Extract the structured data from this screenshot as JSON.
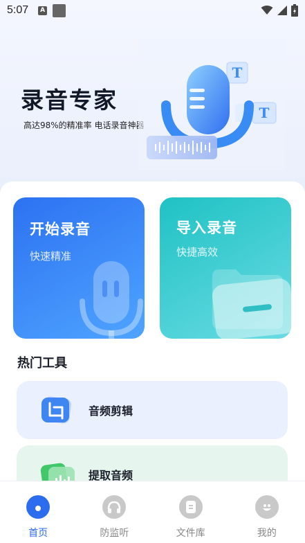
{
  "status_bar": {
    "time": "5:07"
  },
  "hero": {
    "title": "录音专家",
    "subtitle": "高达98%的精准率 电话录音神器"
  },
  "cards": [
    {
      "title": "开始录音",
      "subtitle": "快速精准"
    },
    {
      "title": "导入录音",
      "subtitle": "快捷高效"
    }
  ],
  "section": {
    "title": "热门工具"
  },
  "tools": [
    {
      "label": "音频剪辑"
    },
    {
      "label": "提取音频"
    }
  ],
  "nav": {
    "items": [
      {
        "label": "首页"
      },
      {
        "label": "防监听"
      },
      {
        "label": "文件库"
      },
      {
        "label": "我的"
      }
    ],
    "active_index": 0
  },
  "colors": {
    "accent": "#2c6df0",
    "record_card": "#2c72f2",
    "import_card": "#1fc2c4",
    "tool_blue_bg": "#ebf0fe",
    "tool_green_bg": "#e6f6ee"
  },
  "icons": {
    "hero": "microphone-transcribe-icon",
    "record": "microphone-icon",
    "import": "folder-icon",
    "audio_edit": "crop-icon",
    "extract": "audio-wave-icon",
    "nav": [
      "home-icon",
      "headphones-icon",
      "file-icon",
      "smile-icon"
    ]
  }
}
